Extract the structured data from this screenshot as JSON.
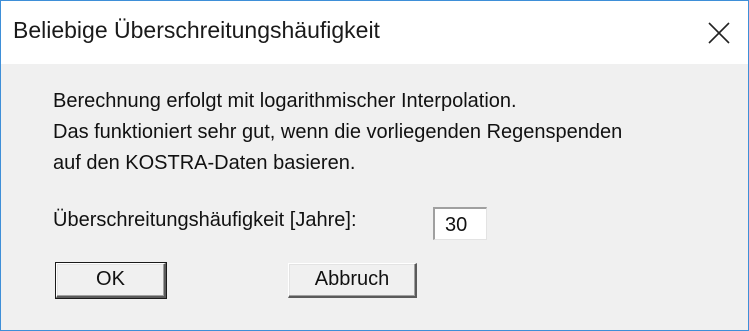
{
  "dialog": {
    "title": "Beliebige Überschreitungshäufigkeit",
    "close_icon": "close-icon"
  },
  "message": {
    "line1": "Berechnung erfolgt mit logarithmischer Interpolation.",
    "line2": "Das funktioniert sehr gut, wenn die vorliegenden Regenspenden",
    "line3": "auf den KOSTRA-Daten basieren."
  },
  "field": {
    "label": "Überschreitungshäufigkeit [Jahre]:",
    "value": "30"
  },
  "buttons": {
    "ok_label": "OK",
    "cancel_label": "Abbruch"
  },
  "colors": {
    "border_accent": "#3e8fd8",
    "dialog_background": "#f0f0f0"
  }
}
